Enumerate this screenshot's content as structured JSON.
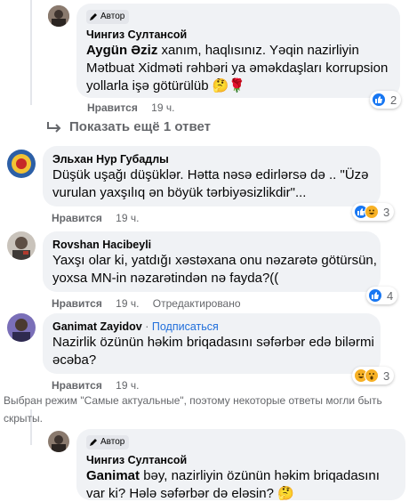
{
  "comments": [
    {
      "author": "Чингиз Султансой",
      "badge": "Автор",
      "tagged": "Aygün Əziz",
      "lines": [
        "xanım, haqlısınız. Yəqin nazirliyin",
        "Mətbuat Xidməti rəhbəri ya əməkdaşları korrupsion",
        "yollarla işə götürülüb"
      ],
      "emoji": "🤔🌹",
      "like": "Нравится",
      "time": "19 ч.",
      "reactions": [
        "like"
      ],
      "reaction_count": "2"
    },
    {
      "author": "Эльхан Нур Губадлы",
      "lines": [
        "Düşük uşağı düşüklər. Hətta nəsə edirlərsə də .. \"Üzə",
        "vurulan yaxşılıq ən böyük tərbiyəsizlikdir\"..."
      ],
      "like": "Нравится",
      "time": "19 ч.",
      "reactions": [
        "like",
        "haha"
      ],
      "reaction_count": "3"
    },
    {
      "author": "Rovshan Hacibeyli",
      "lines": [
        "Yaxşı olar ki, yatdığı xəstəxana onu nəzarətə götürsün,",
        "yoxsa MN-in nəzarətindən nə fayda?(("
      ],
      "like": "Нравится",
      "time": "19 ч.",
      "edited": "Отредактировано",
      "reactions": [
        "like"
      ],
      "reaction_count": "4"
    },
    {
      "author": "Ganimat Zayidov",
      "separator": "·",
      "follow": "Подписаться",
      "lines": [
        "Nazirlik özünün həkim briqadasını səfərbər edə bilərmi",
        "əcəba?"
      ],
      "like": "Нравится",
      "time": "19 ч.",
      "reactions": [
        "haha",
        "wow"
      ],
      "reaction_count": "3"
    },
    {
      "author": "Чингиз Султансой",
      "badge": "Автор",
      "tagged": "Ganimat",
      "lines": [
        "bəy, nazirliyin özünün həkim briqadasını",
        "var ki? Hələ səfərbər də eləsin?"
      ],
      "emoji": "🤔"
    }
  ],
  "more_replies": "Показать ещё 1 ответ",
  "notice": "Выбран режим \"Самые актуальные\", поэтому некоторые ответы могли быть скрыты.",
  "colors": {
    "bubble": "#f0f2f5",
    "like_blue": "#1877f2",
    "haha_yellow": "#f7b125",
    "meta_gray": "#65676b",
    "follow_blue": "#216fdb"
  },
  "icons": [
    "author-pen-icon",
    "reply-arrow-icon",
    "like-reaction-icon",
    "haha-reaction-icon",
    "wow-reaction-icon"
  ]
}
